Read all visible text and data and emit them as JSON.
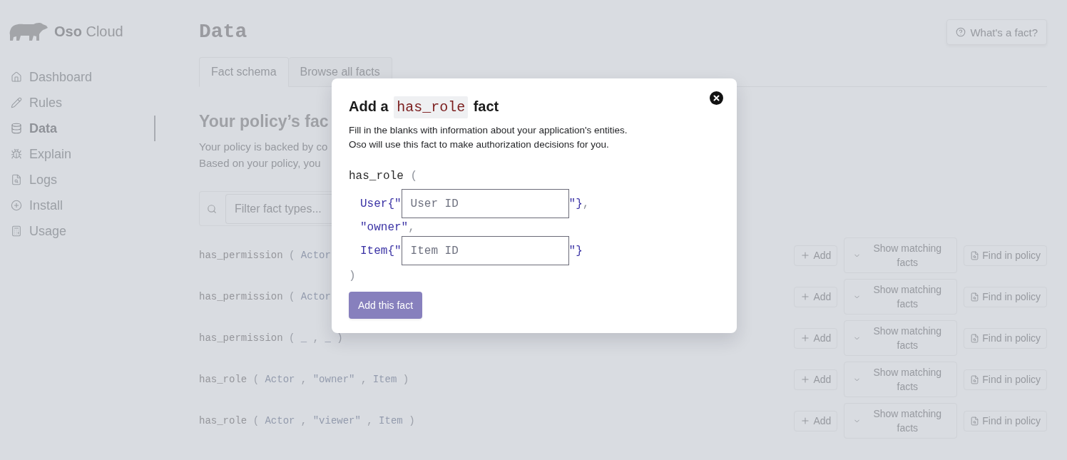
{
  "sidebar": {
    "logo": "**Oso** Cloud",
    "items": [
      {
        "label": "Dashboard",
        "selected": false
      },
      {
        "label": "Rules",
        "selected": false
      },
      {
        "label": "Data",
        "selected": true
      },
      {
        "label": "Explain",
        "selected": false
      },
      {
        "label": "Logs",
        "selected": false
      },
      {
        "label": "Install",
        "selected": false
      },
      {
        "label": "Usage",
        "selected": false
      }
    ]
  },
  "header": {
    "title": "Data",
    "help_button": "What's a fact?"
  },
  "tabs": [
    {
      "label": "Fact schema",
      "selected": true
    },
    {
      "label": "Browse all facts",
      "selected": false
    }
  ],
  "section": {
    "heading": "Your policy’s fac",
    "description": [
      "Your policy is backed by co",
      "Based on your policy, you"
    ]
  },
  "filter": {
    "placeholder": "Filter fact types..."
  },
  "facts": [
    {
      "tokens": [
        {
          "kind": "name",
          "text": "has_permission"
        },
        {
          "kind": "punct",
          "text": "("
        },
        {
          "kind": "type",
          "text": "Actor"
        }
      ],
      "add_button": "Add",
      "show_button": "Show matching facts",
      "find_button": "Find in policy"
    },
    {
      "tokens": [
        {
          "kind": "name",
          "text": "has_permission"
        },
        {
          "kind": "punct",
          "text": "("
        },
        {
          "kind": "type",
          "text": "Actor"
        }
      ],
      "add_button": "Add",
      "show_button": "Show matching facts",
      "find_button": "Find in policy"
    },
    {
      "tokens": [
        {
          "kind": "name",
          "text": "has_permission"
        },
        {
          "kind": "punct",
          "text": "("
        },
        {
          "kind": "wildcard",
          "text": "_"
        },
        {
          "kind": "punct",
          "text": ","
        },
        {
          "kind": "wildcard",
          "text": "_"
        },
        {
          "kind": "punct",
          "text": ")"
        }
      ],
      "add_button": "Add",
      "show_button": "Show matching facts",
      "find_button": "Find in policy"
    },
    {
      "tokens": [
        {
          "kind": "name",
          "text": "has_role"
        },
        {
          "kind": "punct",
          "text": "("
        },
        {
          "kind": "type",
          "text": "Actor"
        },
        {
          "kind": "punct",
          "text": ","
        },
        {
          "kind": "string",
          "text": "\"owner\""
        },
        {
          "kind": "punct",
          "text": ","
        },
        {
          "kind": "type",
          "text": "Item"
        },
        {
          "kind": "punct",
          "text": ")"
        }
      ],
      "add_button": "Add",
      "show_button": "Show matching facts",
      "find_button": "Find in policy"
    },
    {
      "tokens": [
        {
          "kind": "name",
          "text": "has_role"
        },
        {
          "kind": "punct",
          "text": "("
        },
        {
          "kind": "type",
          "text": "Actor"
        },
        {
          "kind": "punct",
          "text": ","
        },
        {
          "kind": "string",
          "text": "\"viewer\""
        },
        {
          "kind": "punct",
          "text": ","
        },
        {
          "kind": "type",
          "text": "Item"
        },
        {
          "kind": "punct",
          "text": ")"
        }
      ],
      "add_button": "Add",
      "show_button": "Show matching facts",
      "find_button": "Find in policy"
    }
  ],
  "dialog": {
    "title": {
      "before": "Add a",
      "code": "has_role",
      "after": "fact"
    },
    "description": [
      "Fill in the blanks with information about your application's entities.",
      "Oso will use this fact to make authorization decisions for you."
    ],
    "predicate": "has_role",
    "open": "(",
    "args": [
      {
        "kind": "input",
        "prefix": "User{\"",
        "placeholder": "User ID",
        "suffix": "\"}",
        "separator": ","
      },
      {
        "kind": "literal",
        "text": "\"owner\"",
        "separator": ","
      },
      {
        "kind": "input",
        "prefix": "Item{\"",
        "placeholder": "Item ID",
        "suffix": "\"}"
      }
    ],
    "close": ")",
    "submit": "Add this fact"
  }
}
